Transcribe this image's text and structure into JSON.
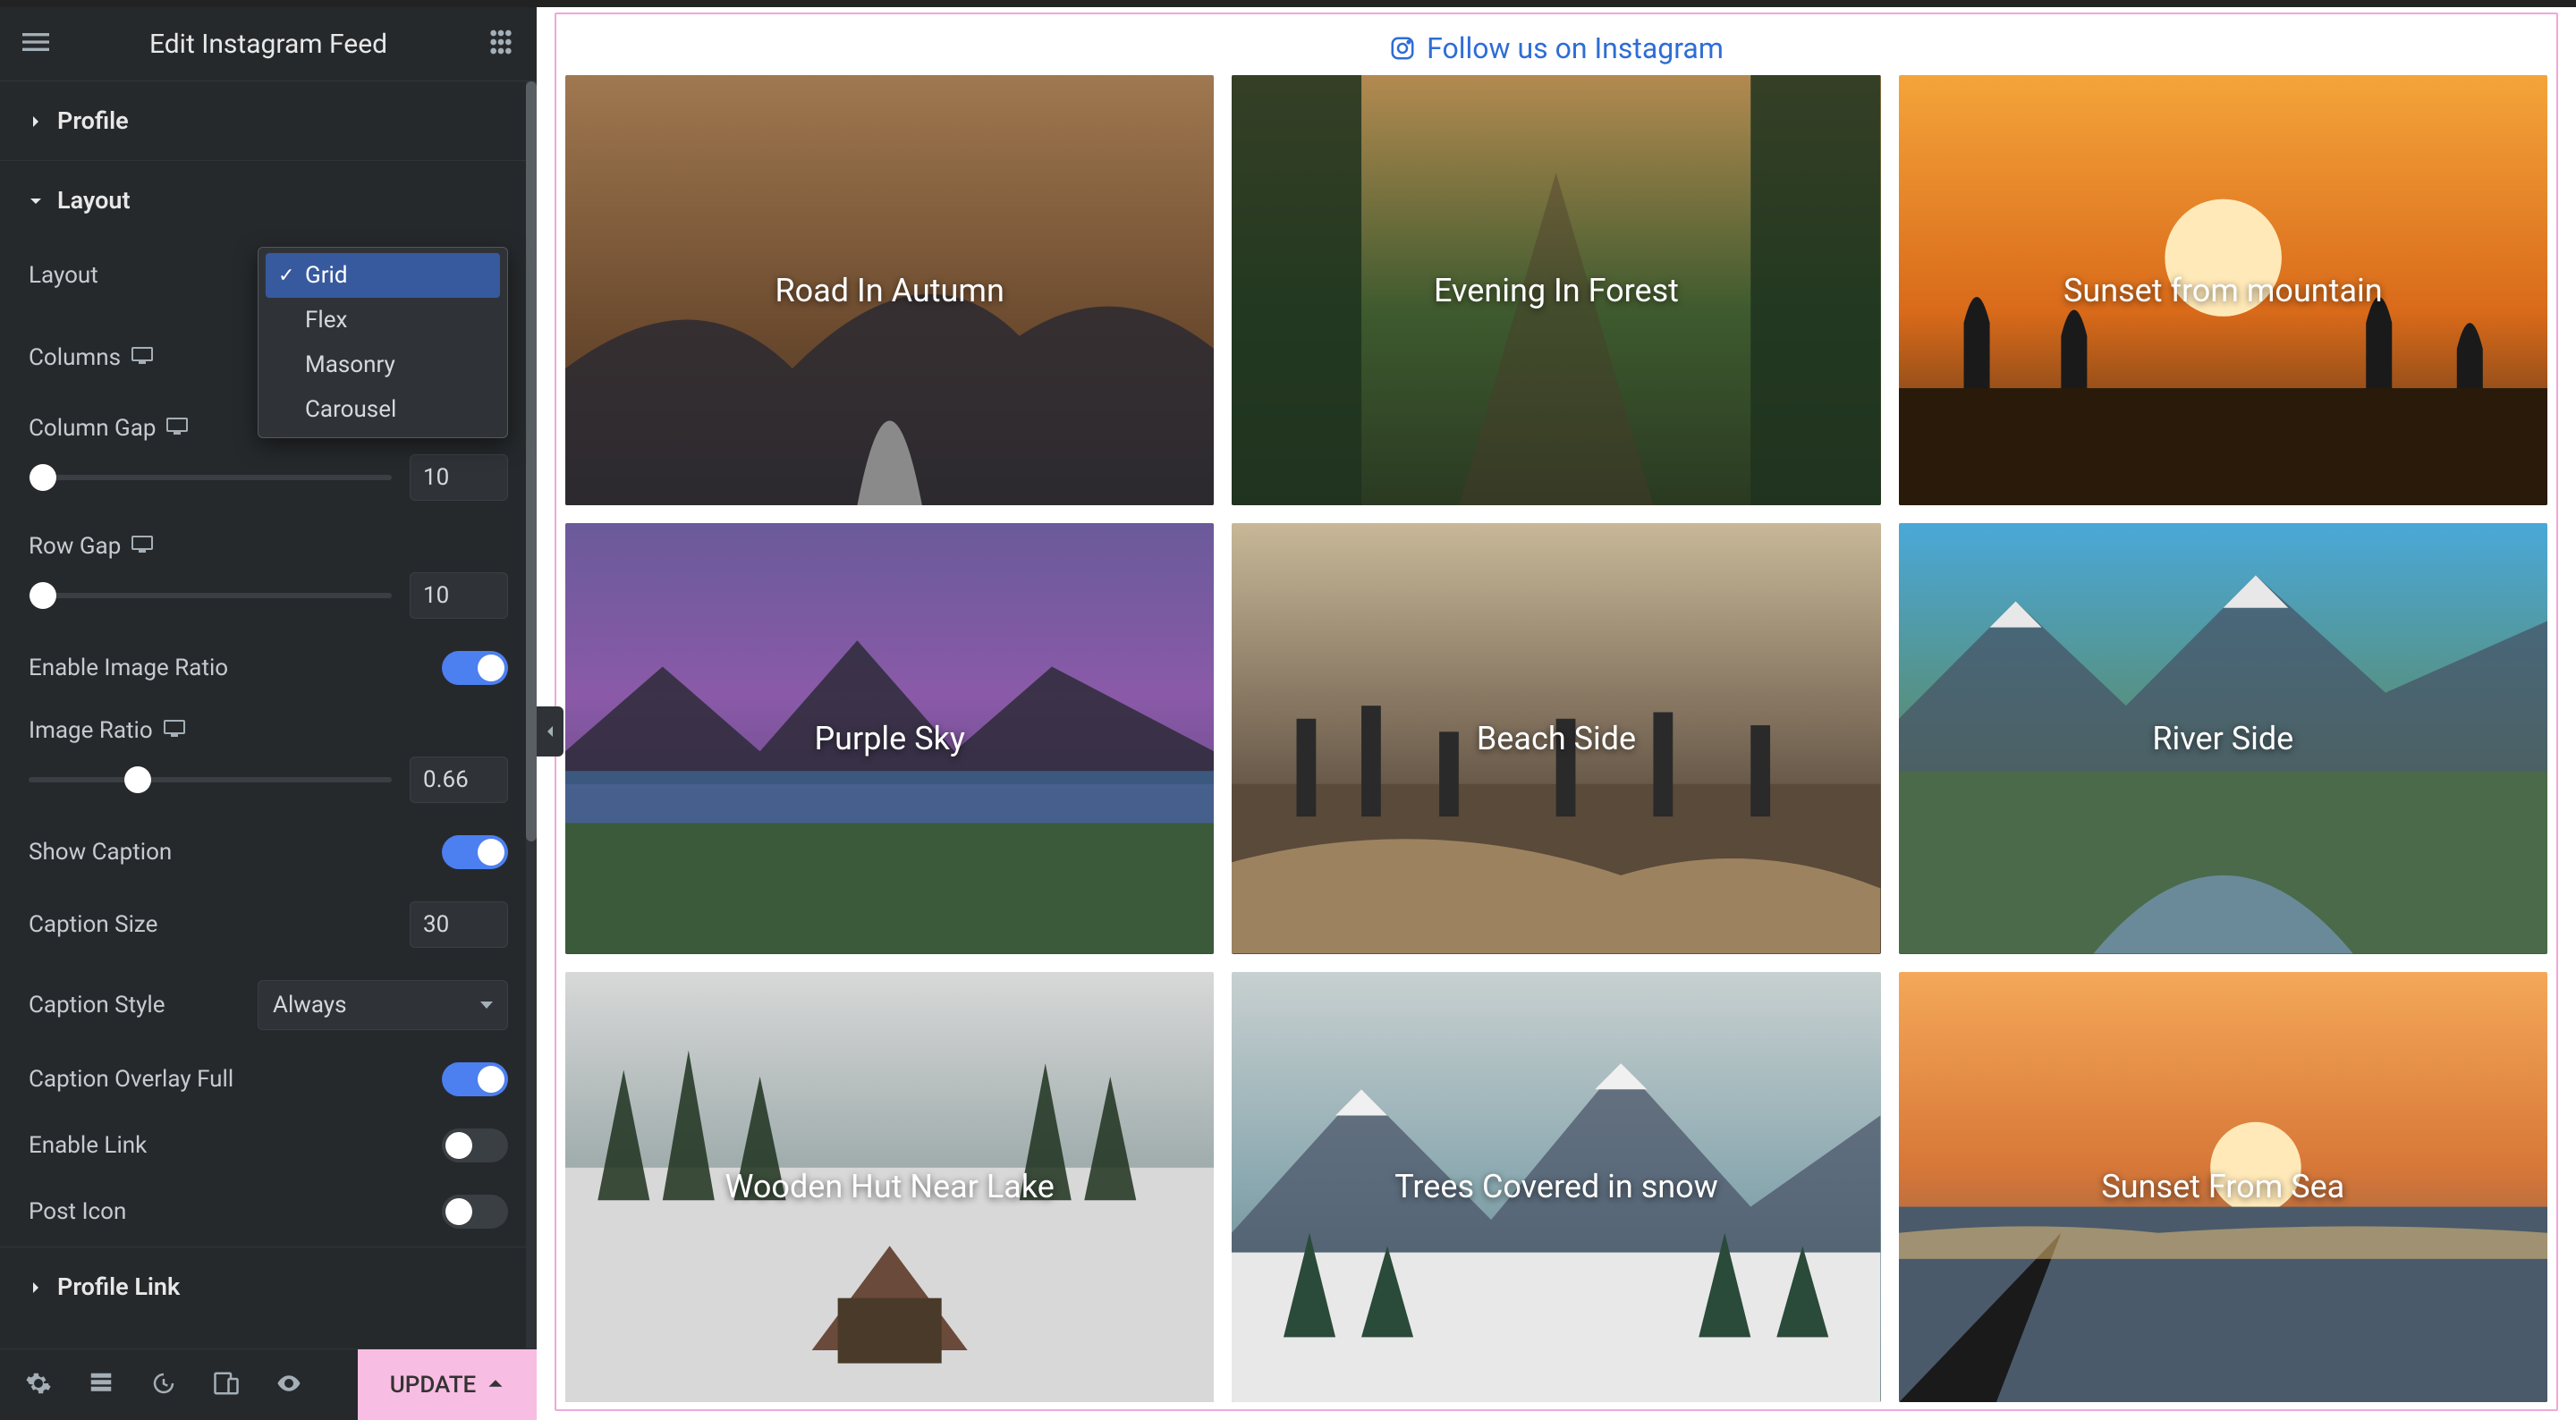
{
  "header": {
    "title": "Edit Instagram Feed"
  },
  "sections": {
    "profile": {
      "title": "Profile"
    },
    "layout": {
      "title": "Layout"
    },
    "profile_link": {
      "title": "Profile Link"
    }
  },
  "controls": {
    "layout_label": "Layout",
    "layout_value": "Grid",
    "layout_options": [
      "Grid",
      "Flex",
      "Masonry",
      "Carousel"
    ],
    "columns_label": "Columns",
    "column_gap_label": "Column Gap",
    "column_gap_value": "10",
    "row_gap_label": "Row Gap",
    "row_gap_value": "10",
    "enable_image_ratio_label": "Enable Image Ratio",
    "image_ratio_label": "Image Ratio",
    "image_ratio_value": "0.66",
    "show_caption_label": "Show Caption",
    "caption_size_label": "Caption Size",
    "caption_size_value": "30",
    "caption_style_label": "Caption Style",
    "caption_style_value": "Always",
    "caption_overlay_full_label": "Caption Overlay Full",
    "enable_link_label": "Enable Link",
    "post_icon_label": "Post Icon"
  },
  "footer": {
    "update_label": "UPDATE"
  },
  "preview": {
    "follow_text": "Follow us on Instagram",
    "cards": [
      "Road In Autumn",
      "Evening In Forest",
      "Sunset from mountain",
      "Purple Sky",
      "Beach Side",
      "River Side",
      "Wooden Hut Near Lake",
      "Trees Covered in snow",
      "Sunset From Sea"
    ]
  }
}
